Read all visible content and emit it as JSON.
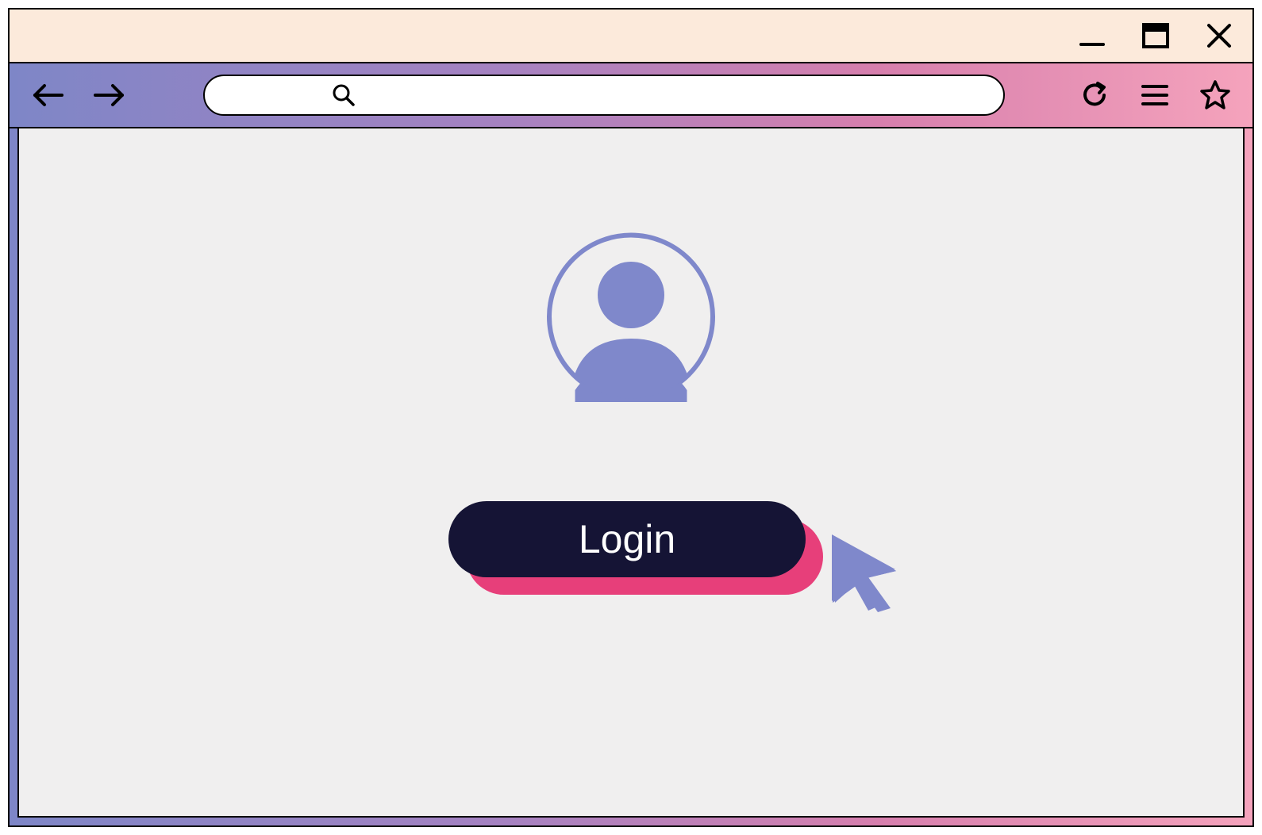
{
  "window": {
    "titlebar": {
      "minimize": "minimize",
      "maximize": "maximize",
      "close": "close"
    }
  },
  "toolbar": {
    "back": "back",
    "forward": "forward",
    "address_value": "",
    "address_placeholder": "",
    "reload": "reload",
    "menu": "menu",
    "bookmark": "bookmark"
  },
  "page": {
    "avatar": "user-avatar",
    "login_label": "Login"
  },
  "colors": {
    "titlebar_bg": "#FCEADB",
    "gradient_start": "#7E86C7",
    "gradient_end": "#F5A3BC",
    "viewport_bg": "#F0EFEF",
    "button_bg": "#151435",
    "button_shadow": "#E73F7A",
    "avatar_fill": "#7F88CB",
    "cursor_fill": "#7F88CB"
  }
}
